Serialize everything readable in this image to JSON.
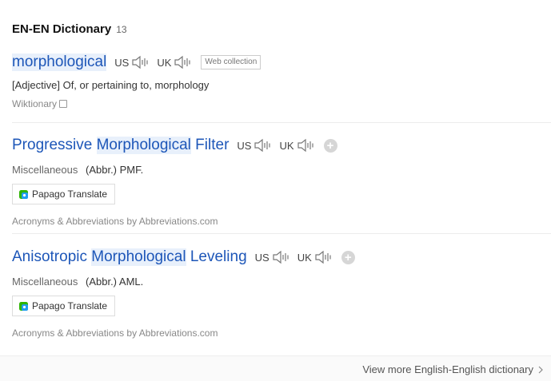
{
  "header": {
    "title": "EN-EN Dictionary",
    "count": "13"
  },
  "pron": {
    "us_label": "US",
    "uk_label": "UK",
    "speaker_icon": "speaker-icon"
  },
  "entries": [
    {
      "word": "morphological",
      "badge": "Web collection",
      "definition": "[Adjective] Of, or pertaining to, morphology",
      "source": "Wiktionary"
    },
    {
      "word_pre": "Progressive ",
      "word_hl": "Morphological",
      "word_post": " Filter",
      "category": "Miscellaneous",
      "definition": "(Abbr.) PMF.",
      "translate_label": "Papago Translate",
      "source": "Acronyms & Abbreviations by Abbreviations.com"
    },
    {
      "word_pre": "Anisotropic ",
      "word_hl": "Morphological",
      "word_post": " Leveling",
      "category": "Miscellaneous",
      "definition": "(Abbr.) AML.",
      "translate_label": "Papago Translate",
      "source": "Acronyms & Abbreviations by Abbreviations.com"
    }
  ],
  "footer": {
    "view_more": "View more English-English dictionary"
  },
  "colors": {
    "link": "#1d56b8",
    "highlight": "#e8f0fb",
    "papago_green": "#2db400",
    "papago_blue": "#1f9df0"
  }
}
